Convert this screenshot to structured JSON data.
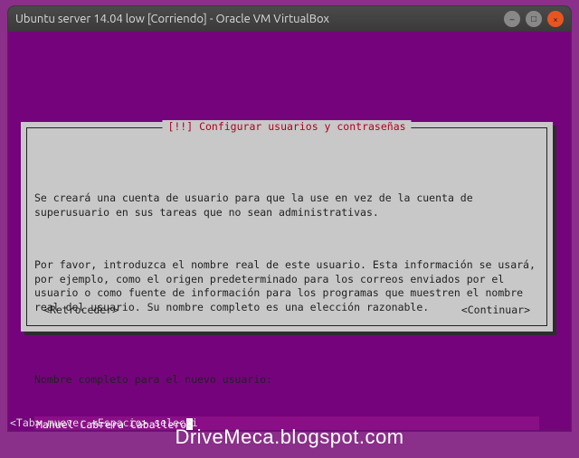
{
  "window": {
    "title": "Ubuntu server 14.04 low [Corriendo] - Oracle VM VirtualBox"
  },
  "dialog": {
    "title": "[!!] Configurar usuarios y contraseñas",
    "para1": "Se creará una cuenta de usuario para que la use en vez de la cuenta de superusuario en sus tareas que no sean administrativas.",
    "para2": "Por favor, introduzca el nombre real de este usuario. Esta información se usará, por ejemplo, como el origen predeterminado para los correos enviados por el usuario o como fuente de información para los programas que muestren el nombre real del usuario. Su nombre completo es una elección razonable.",
    "label": "Nombre completo para el nuevo usuario:",
    "input_value": "Manuel Cabrera Caballero",
    "back": "<Retroceder>",
    "continue": "<Continuar>"
  },
  "hints": "<Tab> mueve; <Espacio> selecci",
  "watermark": "DriveMeca.blogspot.com"
}
